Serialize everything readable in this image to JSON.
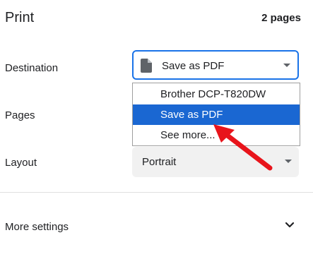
{
  "header": {
    "title": "Print",
    "page_count": "2 pages"
  },
  "destination": {
    "label": "Destination",
    "selected": "Save as PDF",
    "options": [
      "Brother DCP-T820DW",
      "Save as PDF",
      "See more..."
    ],
    "selected_index": 1
  },
  "pages": {
    "label": "Pages"
  },
  "layout": {
    "label": "Layout",
    "selected": "Portrait"
  },
  "more_settings": {
    "label": "More settings"
  },
  "colors": {
    "accent": "#1a73e8",
    "highlight": "#1a67d2",
    "annotation_arrow": "#e8141b"
  },
  "icons": [
    "document-icon",
    "dropdown-caret-icon",
    "chevron-down-icon",
    "red-arrow-annotation"
  ]
}
